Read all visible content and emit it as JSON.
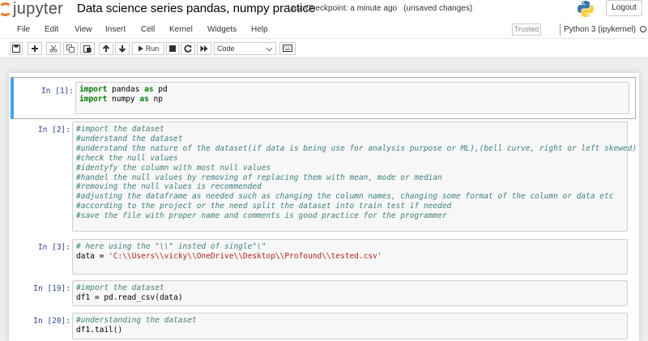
{
  "header": {
    "logo_text": "jupyter",
    "notebook_title": "Data science series pandas, numpy practice",
    "checkpoint": "Last Checkpoint: a minute ago",
    "save_status": "(unsaved changes)",
    "logout_label": "Logout"
  },
  "menubar": {
    "items": [
      "File",
      "Edit",
      "View",
      "Insert",
      "Cell",
      "Kernel",
      "Widgets",
      "Help"
    ],
    "trusted_label": "Trusted",
    "kernel_name": "Python 3 (ipykernel)"
  },
  "toolbar": {
    "run_label": "Run",
    "cell_type": "Code",
    "icons": [
      "save-icon",
      "plus-icon",
      "cut-icon",
      "copy-icon",
      "paste-icon",
      "arrow-up-icon",
      "arrow-down-icon",
      "play-icon",
      "stop-icon",
      "restart-icon",
      "fast-forward-icon",
      "chevron-down-icon",
      "keyboard-icon"
    ]
  },
  "cells": [
    {
      "prompt": "In [1]:",
      "selected": true,
      "lines": [
        [
          {
            "t": "kw",
            "v": "import"
          },
          {
            "t": "tx",
            "v": " pandas "
          },
          {
            "t": "kw",
            "v": "as"
          },
          {
            "t": "tx",
            "v": " pd"
          }
        ],
        [
          {
            "t": "kw",
            "v": "import"
          },
          {
            "t": "tx",
            "v": " numpy "
          },
          {
            "t": "kw",
            "v": "as"
          },
          {
            "t": "tx",
            "v": " np"
          }
        ]
      ]
    },
    {
      "prompt": "In [2]:",
      "lines": [
        [
          {
            "t": "cm",
            "v": "#import the dataset"
          }
        ],
        [
          {
            "t": "cm",
            "v": "#understand the dataset"
          }
        ],
        [
          {
            "t": "cm",
            "v": "#understand the nature of the dataset(if data is being use for analysis purpose or ML),(bell curve, right or left skewed)"
          }
        ],
        [
          {
            "t": "cm",
            "v": "#check the null values"
          }
        ],
        [
          {
            "t": "cm",
            "v": "#identyfy the column with most null values"
          }
        ],
        [
          {
            "t": "cm",
            "v": "#handel the null values by removing of replacing them with mean, mode or median"
          }
        ],
        [
          {
            "t": "cm",
            "v": "#removing the null values is recommended"
          }
        ],
        [
          {
            "t": "cm",
            "v": "#adjusting the dataframe as needed such as changing the column names, changing some format of the column or data etc"
          }
        ],
        [
          {
            "t": "cm",
            "v": "#according to the project or the need split the dataset into train test if needed"
          }
        ],
        [
          {
            "t": "cm",
            "v": "#save the file with proper name and comments is good practice for the programmer"
          }
        ]
      ]
    },
    {
      "prompt": "In [3]:",
      "lines": [
        [
          {
            "t": "cm",
            "v": "# here using the \"\\\\\" insted of single\"\\\""
          }
        ],
        [
          {
            "t": "tx",
            "v": "data = "
          },
          {
            "t": "st",
            "v": "'C:\\\\Users\\\\vicky\\\\OneDrive\\\\Desktop\\\\Profound\\\\tested.csv'"
          }
        ]
      ]
    },
    {
      "prompt": "In [19]:",
      "lines": [
        [
          {
            "t": "cm",
            "v": "#import the dataset"
          }
        ],
        [
          {
            "t": "tx",
            "v": "df1 = pd.read_csv(data)"
          }
        ]
      ]
    },
    {
      "prompt": "In [20]:",
      "lines": [
        [
          {
            "t": "cm",
            "v": "#understanding the dataset"
          }
        ],
        [
          {
            "t": "tx",
            "v": "df1.tail()"
          }
        ]
      ]
    }
  ]
}
